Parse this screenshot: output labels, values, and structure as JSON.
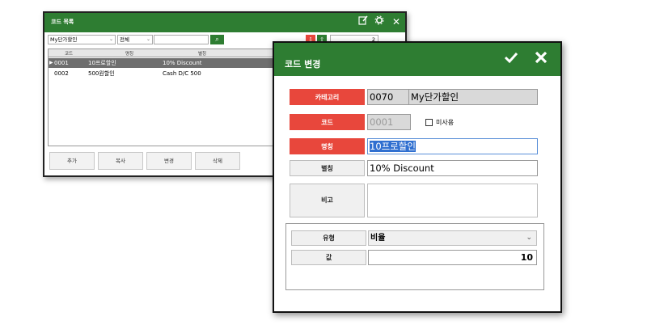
{
  "list_window": {
    "title": "코드 목록",
    "icons": [
      "edit-icon",
      "settings-icon",
      "close-icon"
    ],
    "filters": {
      "category_value": "My단가할인",
      "usage_value": "전체",
      "search_value": "",
      "page_value": "2"
    },
    "grid": {
      "columns": [
        "코드",
        "명칭",
        "별칭"
      ],
      "rows": [
        {
          "code": "0001",
          "name": "10프로할인",
          "alias": "10% Discount",
          "selected": true
        },
        {
          "code": "0002",
          "name": "500원할인",
          "alias": "Cash D/C 500",
          "selected": false
        }
      ]
    },
    "buttons": {
      "add": "추가",
      "copy": "복사",
      "edit": "변경",
      "delete": "삭제"
    }
  },
  "edit_dialog": {
    "title": "코드 변경",
    "icons": [
      "check-icon",
      "close-icon"
    ],
    "labels": {
      "category": "카테고리",
      "code": "코드",
      "name": "명칭",
      "alias": "별칭",
      "note": "비고",
      "type": "유형",
      "value": "값"
    },
    "category_code": "0070",
    "category_name": "My단가할인",
    "code_value": "0001",
    "unused_label": "미사용",
    "unused_checked": false,
    "name_value": "10프로할인",
    "alias_value": "10% Discount",
    "note_value": "",
    "type_value": "비율",
    "value_value": "10"
  },
  "colors": {
    "titlebar": "#2e7d32",
    "required_label": "#e8473c",
    "selection": "#2f6fd0",
    "selected_row": "#6e6e6e"
  }
}
